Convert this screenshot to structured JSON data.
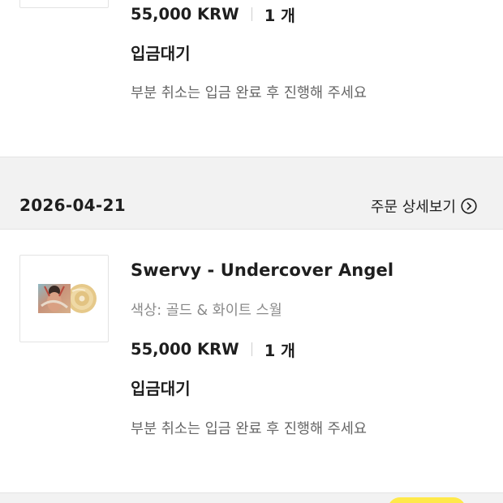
{
  "orders": [
    {
      "price": "55,000 KRW",
      "quantity": "1 개",
      "status": "입금대기",
      "note": "부분 취소는 입금 완료 후 진행해 주세요"
    },
    {
      "date": "2026-04-21",
      "detail_link": "주문 상세보기",
      "product_title": "Swervy - Undercover Angel",
      "option_label": "색상:",
      "option_value": "골드 & 화이트 스월",
      "price": "55,000 KRW",
      "quantity": "1 개",
      "status": "입금대기",
      "note": "부분 취소는 입금 완료 후 진행해 주세요"
    }
  ],
  "icons": {
    "detail_arrow": "chevron-right-circle-icon"
  },
  "colors": {
    "background": "#f2f2f2",
    "card": "#ffffff",
    "text_primary": "#1e1e1e",
    "text_secondary": "#8a8a8a",
    "floating_button": "#ffe94a"
  }
}
